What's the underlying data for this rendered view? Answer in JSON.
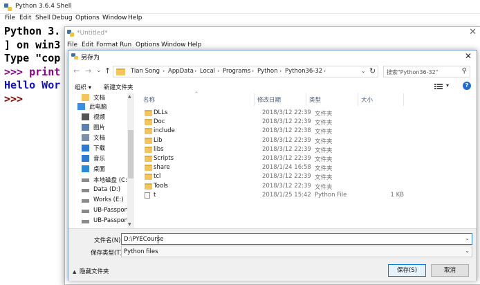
{
  "shell": {
    "title": "Python 3.6.4 Shell",
    "menu": [
      "File",
      "Edit",
      "Shell",
      "Debug",
      "Options",
      "Window",
      "Help"
    ],
    "console_lines": [
      {
        "text": "Python 3.",
        "kind": "normal"
      },
      {
        "text": "] on win3",
        "kind": "normal"
      },
      {
        "text": "Type \"cop",
        "kind": "normal"
      },
      {
        "text": ">>> print",
        "kind": "print"
      },
      {
        "text": "Hello Wor",
        "kind": "out"
      },
      {
        "text": ">>>",
        "kind": "prompt"
      }
    ]
  },
  "editor": {
    "title": "*Untitled*",
    "menu": [
      "File",
      "Edit",
      "Format",
      "Run",
      "Options",
      "Window",
      "Help"
    ]
  },
  "dialog": {
    "title": "另存为",
    "close_glyph": "✕",
    "nav": {
      "back": "←",
      "forward": "→",
      "recent": "⌄",
      "up": "↑"
    },
    "breadcrumb": [
      "Tian Song",
      "AppData",
      "Local",
      "Programs",
      "Python",
      "Python36-32"
    ],
    "search_placeholder": "搜索\"Python36-32\"",
    "toolbar": {
      "organize": "组织 ▾",
      "new_folder": "新建文件夹",
      "help": "?"
    },
    "nav_pane": [
      {
        "label": "文档",
        "icon": "folder-icon",
        "level": 1
      },
      {
        "label": "此电脑",
        "icon": "computer-icon",
        "level": 0
      },
      {
        "label": "视频",
        "icon": "video-icon",
        "level": 1
      },
      {
        "label": "图片",
        "icon": "picture-icon",
        "level": 1
      },
      {
        "label": "文档",
        "icon": "document-icon",
        "level": 1
      },
      {
        "label": "下载",
        "icon": "download-icon",
        "level": 1
      },
      {
        "label": "音乐",
        "icon": "music-icon",
        "level": 1
      },
      {
        "label": "桌面",
        "icon": "desktop-icon",
        "level": 1
      },
      {
        "label": "本地磁盘 (C:)",
        "icon": "drive-icon",
        "level": 1
      },
      {
        "label": "Data (D:)",
        "icon": "drive-icon",
        "level": 1
      },
      {
        "label": "Works (E:)",
        "icon": "drive-icon",
        "level": 1
      },
      {
        "label": "UB-Passport (H",
        "icon": "drive-icon",
        "level": 1
      },
      {
        "label": "UB-Passport (H",
        "icon": "drive-icon",
        "level": 1
      }
    ],
    "columns": [
      "名称",
      "修改日期",
      "类型",
      "大小"
    ],
    "files": [
      {
        "name": "DLLs",
        "date": "2018/3/12 22:39",
        "type": "文件夹",
        "size": "",
        "kind": "folder"
      },
      {
        "name": "Doc",
        "date": "2018/3/12 22:39",
        "type": "文件夹",
        "size": "",
        "kind": "folder"
      },
      {
        "name": "include",
        "date": "2018/3/12 22:38",
        "type": "文件夹",
        "size": "",
        "kind": "folder"
      },
      {
        "name": "Lib",
        "date": "2018/3/12 22:39",
        "type": "文件夹",
        "size": "",
        "kind": "folder"
      },
      {
        "name": "libs",
        "date": "2018/3/12 22:39",
        "type": "文件夹",
        "size": "",
        "kind": "folder"
      },
      {
        "name": "Scripts",
        "date": "2018/3/12 22:39",
        "type": "文件夹",
        "size": "",
        "kind": "folder"
      },
      {
        "name": "share",
        "date": "2018/1/24 16:58",
        "type": "文件夹",
        "size": "",
        "kind": "folder"
      },
      {
        "name": "tcl",
        "date": "2018/3/12 22:39",
        "type": "文件夹",
        "size": "",
        "kind": "folder"
      },
      {
        "name": "Tools",
        "date": "2018/3/12 22:39",
        "type": "文件夹",
        "size": "",
        "kind": "folder"
      },
      {
        "name": "t",
        "date": "2018/1/25 15:42",
        "type": "Python File",
        "size": "1 KB",
        "kind": "file"
      }
    ],
    "filename_label": "文件名(N):",
    "filename_value": "D:\\PYECourse",
    "filetype_label": "保存类型(T):",
    "filetype_value": "Python files",
    "hide_folders": "隐藏文件夹",
    "save_button": "保存(S)",
    "cancel_button": "取消"
  }
}
